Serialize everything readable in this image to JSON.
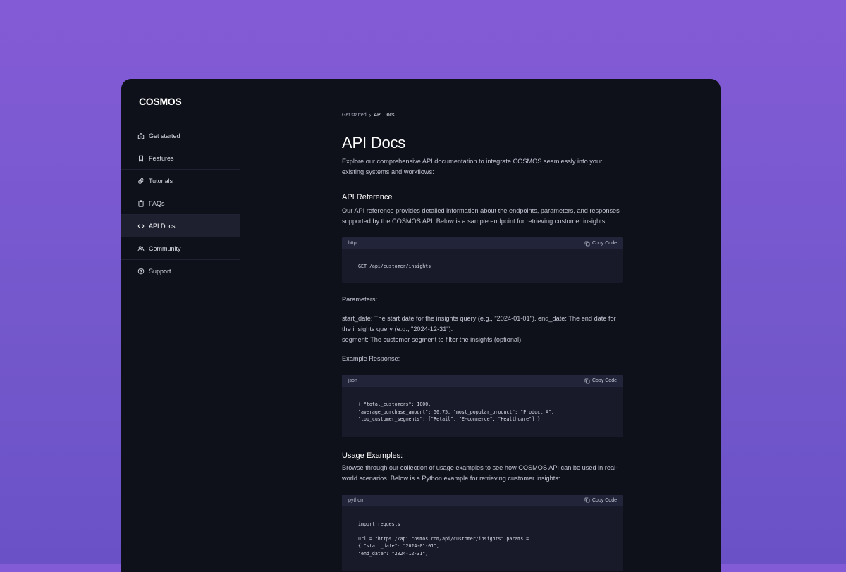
{
  "app": {
    "logo": "COSMOS"
  },
  "sidebar": {
    "items": [
      {
        "label": "Get started",
        "icon": "home-icon"
      },
      {
        "label": "Features",
        "icon": "bookmark-icon"
      },
      {
        "label": "Tutorials",
        "icon": "paperclip-icon"
      },
      {
        "label": "FAQs",
        "icon": "clipboard-icon"
      },
      {
        "label": "API Docs",
        "icon": "code-icon",
        "active": true
      },
      {
        "label": "Community",
        "icon": "users-icon"
      },
      {
        "label": "Support",
        "icon": "help-circle-icon"
      }
    ]
  },
  "breadcrumb": {
    "parent": "Get started",
    "separator": "›",
    "current": "API Docs"
  },
  "page": {
    "title": "API Docs",
    "intro": "Explore our comprehensive API documentation to integrate COSMOS seamlessly into your existing systems and workflows:",
    "api_reference": {
      "heading": "API Reference",
      "text": "Our API reference provides detailed information about the endpoints, parameters, and responses supported by the COSMOS API. Below is a sample endpoint for retrieving customer insights:"
    },
    "code_http": {
      "lang": "http",
      "copy_label": "Copy Code",
      "code": "GET /api/customer/insights"
    },
    "params_label": "Parameters:",
    "params_line1": "start_date: The start date for the insights query (e.g., \"2024-01-01\"). end_date: The end date for the insights query (e.g., \"2024-12-31\").",
    "params_line2": "segment: The customer segment to filter the insights (optional).",
    "response_label": "Example Response:",
    "code_json": {
      "lang": "json",
      "copy_label": "Copy Code",
      "code": "{ \"total_customers\": 1000,\n\"average_purchase_amount\": 50.75, \"most_popular_product\": \"Product A\",\n\"top_customer_segments\": [\"Retail\", \"E-commerce\", \"Healthcare\"] }"
    },
    "usage": {
      "heading": "Usage Examples:",
      "text": "Browse through our collection of usage examples to see how COSMOS API can be used in real-world scenarios. Below is a Python example for retrieving customer insights:"
    },
    "code_python": {
      "lang": "python",
      "copy_label": "Copy Code",
      "code": "import requests\n\nurl = \"https://api.cosmos.com/api/customer/insights\" params =\n{ \"start_date\": \"2024-01-01\",\n\"end_date\": \"2024-12-31\","
    }
  }
}
